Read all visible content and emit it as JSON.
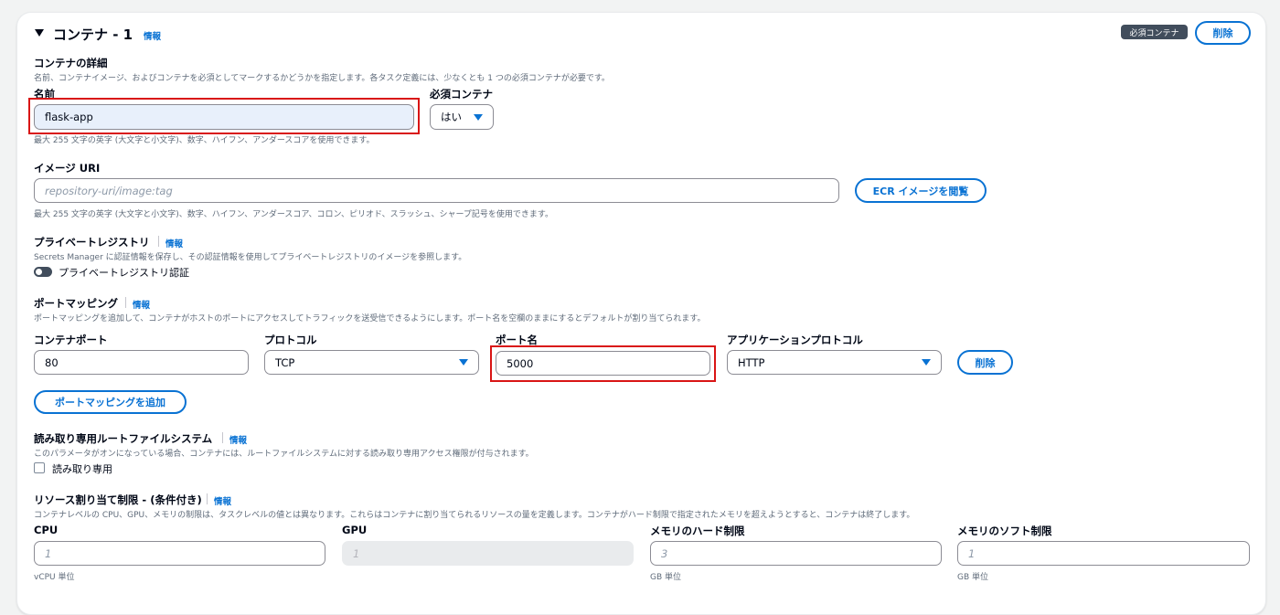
{
  "container": {
    "title": "コンテナ - 1",
    "info": "情報",
    "essential_badge": "必須コンテナ",
    "delete_label": "削除"
  },
  "details": {
    "heading": "コンテナの詳細",
    "description": "名前、コンテナイメージ、およびコンテナを必須としてマークするかどうかを指定します。各タスク定義には、少なくとも 1 つの必須コンテナが必要です。"
  },
  "name_field": {
    "label": "名前",
    "value": "flask-app",
    "hint": "最大 255 文字の英字 (大文字と小文字)、数字、ハイフン、アンダースコアを使用できます。"
  },
  "essential_field": {
    "label": "必須コンテナ",
    "value": "はい"
  },
  "image_field": {
    "label": "イメージ URI",
    "placeholder": "repository-uri/image:tag",
    "browse_label": "ECR イメージを閲覧",
    "hint": "最大 255 文字の英字 (大文字と小文字)、数字、ハイフン、アンダースコア、コロン、ピリオド、スラッシュ、シャープ記号を使用できます。"
  },
  "private_registry": {
    "heading": "プライベートレジストリ",
    "info": "情報",
    "description": "Secrets Manager に認証情報を保存し、その認証情報を使用してプライベートレジストリのイメージを参照します。",
    "toggle_label": "プライベートレジストリ認証"
  },
  "port_mapping": {
    "heading": "ポートマッピング",
    "info": "情報",
    "description": "ポートマッピングを追加して、コンテナがホストのポートにアクセスしてトラフィックを送受信できるようにします。ポート名を空欄のままにするとデフォルトが割り当てられます。",
    "container_port_label": "コンテナポート",
    "container_port_value": "80",
    "protocol_label": "プロトコル",
    "protocol_value": "TCP",
    "port_name_label": "ポート名",
    "port_name_value": "5000",
    "app_protocol_label": "アプリケーションプロトコル",
    "app_protocol_value": "HTTP",
    "remove_label": "削除",
    "add_label": "ポートマッピングを追加"
  },
  "readonly_fs": {
    "heading": "読み取り専用ルートファイルシステム",
    "info": "情報",
    "description": "このパラメータがオンになっている場合、コンテナには、ルートファイルシステムに対する読み取り専用アクセス権限が付与されます。",
    "checkbox_label": "読み取り専用"
  },
  "resources": {
    "heading": "リソース割り当て制限 - (条件付き)",
    "info": "情報",
    "description": "コンテナレベルの CPU、GPU、メモリの制限は、タスクレベルの値とは異なります。これらはコンテナに割り当てられるリソースの量を定義します。コンテナがハード制限で指定されたメモリを超えようとすると、コンテナは終了します。",
    "cpu_label": "CPU",
    "cpu_placeholder": "1",
    "cpu_unit": "vCPU 単位",
    "gpu_label": "GPU",
    "gpu_placeholder": "1",
    "mem_hard_label": "メモリのハード制限",
    "mem_hard_placeholder": "3",
    "mem_hard_unit": "GB 単位",
    "mem_soft_label": "メモリのソフト制限",
    "mem_soft_placeholder": "1",
    "mem_soft_unit": "GB 単位"
  }
}
